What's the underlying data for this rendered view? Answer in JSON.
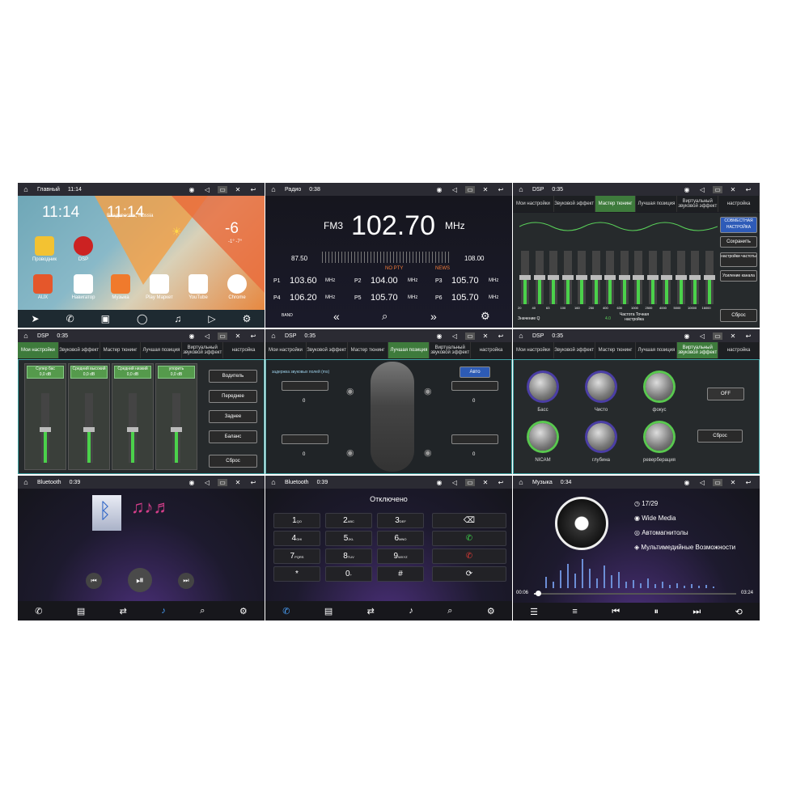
{
  "home": {
    "status_title": "Главный",
    "status_time": "11:14",
    "clock": "11:14",
    "clock_small": "11:14",
    "city": "Владивосток, Russia",
    "temp": "-6",
    "temp_range": "-1° -7°",
    "apps": [
      "Проводник",
      "DSP",
      "AUX",
      "Навигатор",
      "Музыка",
      "Play Маркет",
      "YouTube",
      "Chrome"
    ]
  },
  "radio": {
    "status_title": "Радио",
    "status_time": "0:38",
    "band": "FM3",
    "freq": "102.70",
    "unit": "MHz",
    "min": "87.50",
    "max": "108.00",
    "pty": "NO PTY",
    "news": "NEWS",
    "presets": [
      {
        "p": "P1",
        "f": "103.60"
      },
      {
        "p": "P2",
        "f": "104.00"
      },
      {
        "p": "P3",
        "f": "105.70"
      },
      {
        "p": "P4",
        "f": "106.20"
      },
      {
        "p": "P5",
        "f": "105.70"
      },
      {
        "p": "P6",
        "f": "105.70"
      }
    ],
    "mhz": "MHz",
    "band_btn": "BAND"
  },
  "dsp": {
    "status_title": "DSP",
    "time1": "0:35",
    "tabs": [
      "Мои настройки",
      "Звуковой эффект",
      "Мастер тюнинг",
      "Лучшая позиция",
      "Виртуальный звуковой эффект",
      "настройка"
    ],
    "eq_freqs": [
      "20",
      "40",
      "63",
      "100",
      "160",
      "250",
      "400",
      "630",
      "1000",
      "2500",
      "4000",
      "5000",
      "10000",
      "16000"
    ],
    "eq_buttons": [
      "СОВМЕСТНАЯ НАСТРОЙКА",
      "Сохранить",
      "настройки частоты",
      "Усиление канала",
      "Сброс"
    ],
    "q_label": "Значение Q",
    "q_value": "4.0",
    "fine_tune": "Частота Точная настройка",
    "effects": [
      "Супер бас",
      "Средний высокий",
      "Средний низкий",
      "упорить"
    ],
    "effect_db": "0,0 dB",
    "positions": [
      "Водитель",
      "Переднее",
      "Заднее",
      "Баланс",
      "Сброс"
    ],
    "delay_title": "задержка звуковых полей (ms)",
    "auto": "Авто",
    "zero": "0",
    "knobs": [
      "Басс",
      "Чисто",
      "фокус",
      "NICAM",
      "глубина",
      "реверберация"
    ],
    "off": "OFF",
    "reset": "Сброс"
  },
  "bt": {
    "status_title": "Bluetooth",
    "time1": "0:39",
    "disconnected": "Отключено",
    "keys": [
      "1",
      "2",
      "3",
      "4",
      "5",
      "6",
      "7",
      "8",
      "9",
      "*",
      "0",
      "#"
    ],
    "subs": [
      "QO",
      "ABC",
      "DEF",
      "GHI",
      "JKL",
      "MNO",
      "PQRS",
      "TUV",
      "WXYZ",
      "",
      "+",
      ""
    ]
  },
  "music": {
    "status_title": "Музыка",
    "time1": "0:34",
    "track": "17/29",
    "source": "Wide Media",
    "album": "Автомагнитолы",
    "artist": "Мультимедийные Возможности",
    "elapsed": "00:06",
    "total": "03:24"
  }
}
